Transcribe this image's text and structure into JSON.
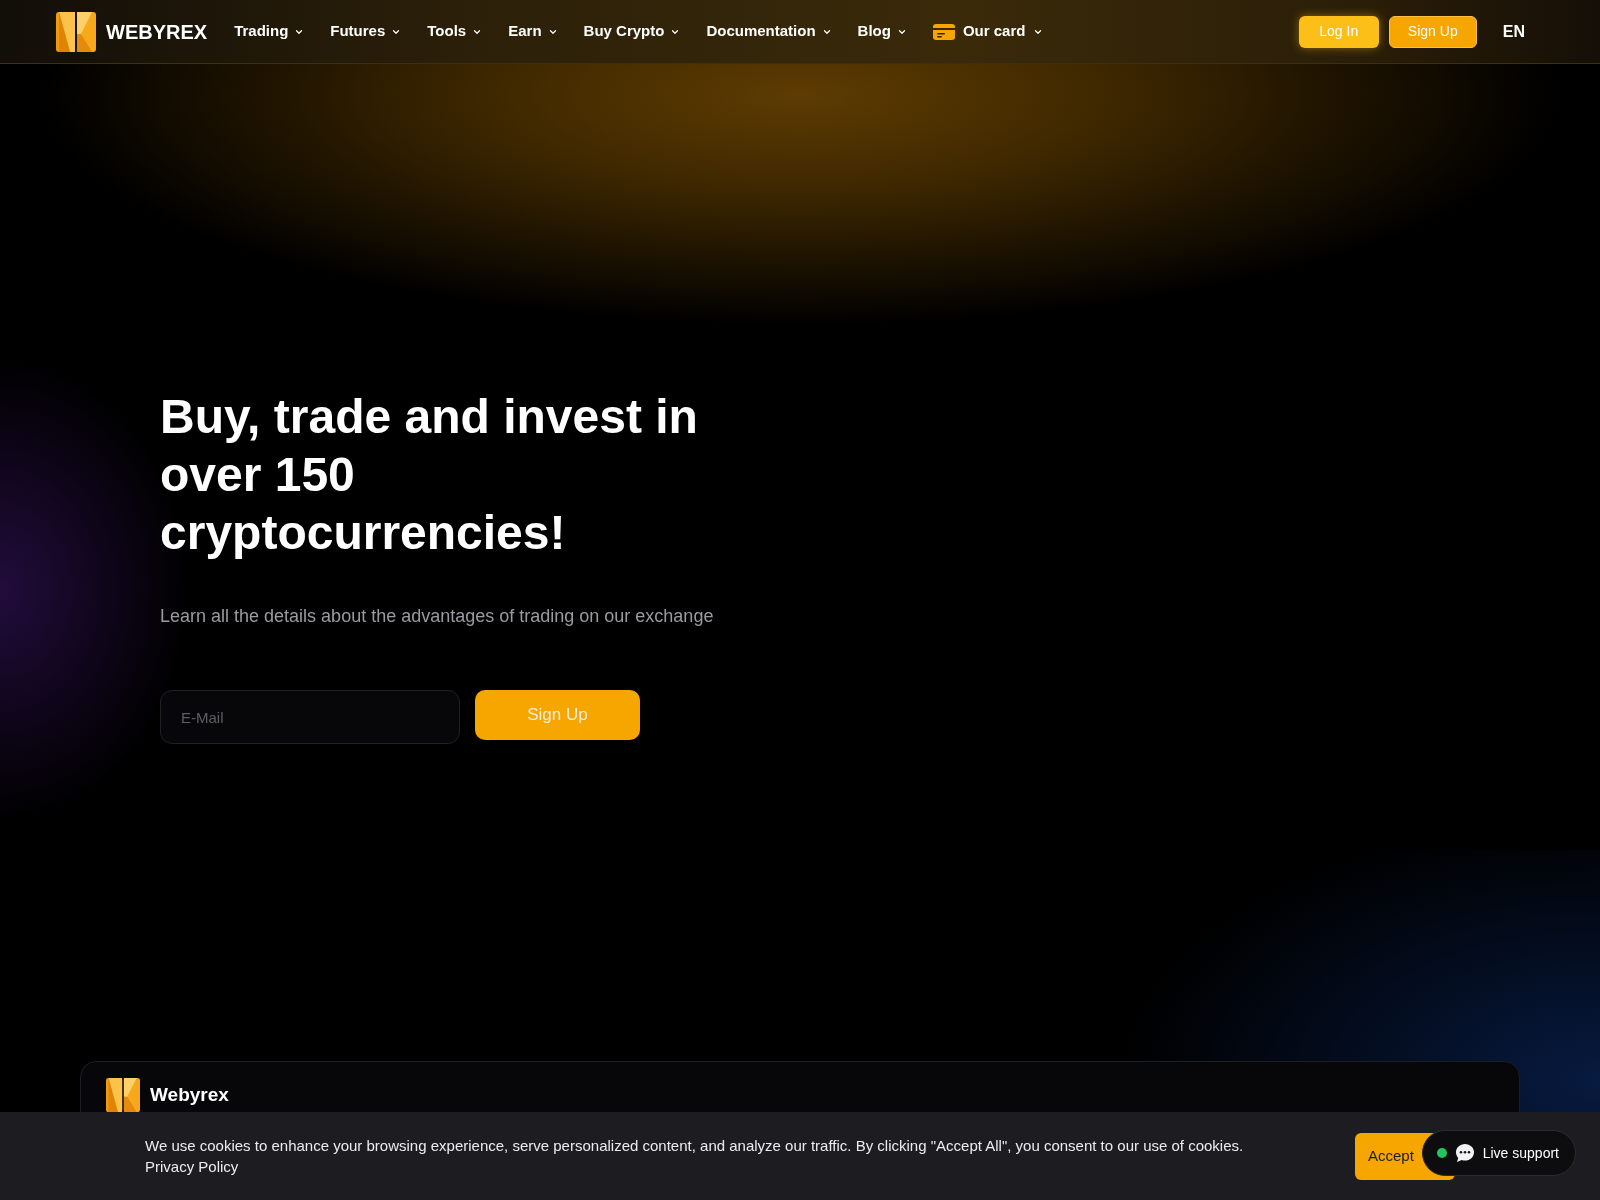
{
  "header": {
    "brand": "WEBYREX",
    "nav": [
      {
        "label": "Trading",
        "kind": "dropdown"
      },
      {
        "label": "Futures",
        "kind": "dropdown"
      },
      {
        "label": "Tools",
        "kind": "dropdown"
      },
      {
        "label": "Earn",
        "kind": "dropdown"
      },
      {
        "label": "Buy Crypto",
        "kind": "dropdown"
      },
      {
        "label": "Documentation",
        "kind": "dropdown"
      },
      {
        "label": "Blog",
        "kind": "dropdown"
      },
      {
        "label": "Our card",
        "kind": "card"
      }
    ],
    "login": "Log In",
    "signup": "Sign Up",
    "language": "EN"
  },
  "hero": {
    "title": "Buy, trade and invest in over 150 cryptocurrencies!",
    "subtitle": "Learn all the details about the advantages of trading on our exchange",
    "email": {
      "placeholder": "E-Mail"
    },
    "cta": "Sign Up"
  },
  "info_card": {
    "brand": "Webyrex"
  },
  "cookie_banner": {
    "text": "We use cookies to enhance your browsing experience, serve personalized content, and analyze our traffic. By clicking \"Accept All\", you consent to our use of cookies.",
    "link": "Privacy Policy",
    "accept": "Accept"
  },
  "live_support": {
    "label": "Live support",
    "online": true
  }
}
